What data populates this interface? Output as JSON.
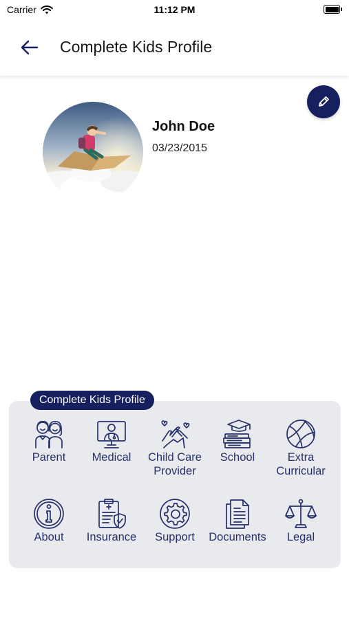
{
  "status_bar": {
    "carrier": "Carrier",
    "time": "11:12 PM"
  },
  "header": {
    "title": "Complete Kids Profile"
  },
  "profile": {
    "name": "John Doe",
    "dob": "03/23/2015"
  },
  "menu": {
    "title": "Complete Kids Profile",
    "items": [
      {
        "label": "Parent",
        "icon": "parents-icon"
      },
      {
        "label": "Medical",
        "icon": "doctor-icon"
      },
      {
        "label": "Child Care Provider",
        "icon": "caring-hands-icon"
      },
      {
        "label": "School",
        "icon": "graduation-books-icon"
      },
      {
        "label": "Extra Curricular",
        "icon": "ball-icon"
      },
      {
        "label": "About",
        "icon": "info-icon"
      },
      {
        "label": "Insurance",
        "icon": "insurance-icon"
      },
      {
        "label": "Support",
        "icon": "gear-support-icon"
      },
      {
        "label": "Documents",
        "icon": "documents-icon"
      },
      {
        "label": "Legal",
        "icon": "scales-icon"
      }
    ]
  },
  "colors": {
    "accent": "#17205f",
    "icon_stroke": "#26306b",
    "panel_bg": "#e9eaed"
  }
}
